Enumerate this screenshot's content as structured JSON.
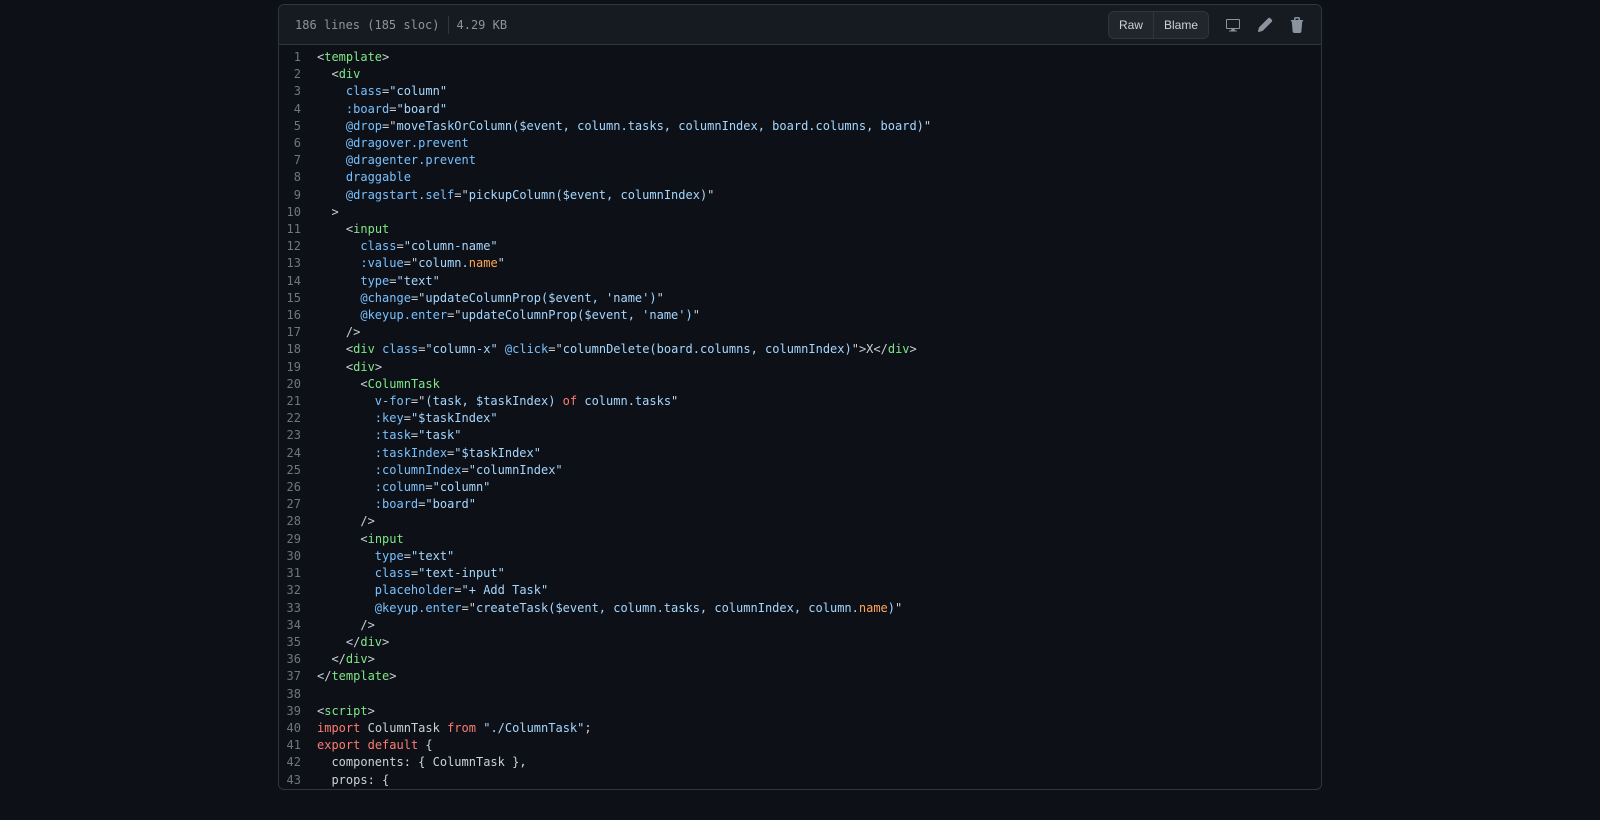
{
  "header": {
    "file_info": "186 lines (185 sloc)",
    "file_size": "4.29 KB",
    "raw_label": "Raw",
    "blame_label": "Blame"
  },
  "code": {
    "lines": [
      {
        "n": 1,
        "html": "<span class='punct'>&lt;</span><span class='tag'>template</span><span class='punct'>&gt;</span>"
      },
      {
        "n": 2,
        "html": "  <span class='punct'>&lt;</span><span class='tag'>div</span>"
      },
      {
        "n": 3,
        "html": "    <span class='attr'>class</span><span class='punct'>=</span><span class='str'>\"column\"</span>"
      },
      {
        "n": 4,
        "html": "    <span class='attr'>:board</span><span class='punct'>=</span><span class='str'>\"board\"</span>"
      },
      {
        "n": 5,
        "html": "    <span class='attr'>@drop</span><span class='punct'>=</span><span class='punct'>\"</span><span class='str'>moveTaskOrColumn($event, column.tasks, columnIndex, board.columns, board)</span><span class='punct'>\"</span>"
      },
      {
        "n": 6,
        "html": "    <span class='attr'>@dragover.prevent</span>"
      },
      {
        "n": 7,
        "html": "    <span class='attr'>@dragenter.prevent</span>"
      },
      {
        "n": 8,
        "html": "    <span class='attr'>draggable</span>"
      },
      {
        "n": 9,
        "html": "    <span class='attr'>@dragstart.self</span><span class='punct'>=</span><span class='punct'>\"</span><span class='str'>pickupColumn($event, columnIndex)</span><span class='punct'>\"</span>"
      },
      {
        "n": 10,
        "html": "  <span class='punct'>&gt;</span>"
      },
      {
        "n": 11,
        "html": "    <span class='punct'>&lt;</span><span class='tag'>input</span>"
      },
      {
        "n": 12,
        "html": "      <span class='attr'>class</span><span class='punct'>=</span><span class='str'>\"column-name\"</span>"
      },
      {
        "n": 13,
        "html": "      <span class='attr'>:value</span><span class='punct'>=</span><span class='punct'>\"</span><span class='str'>column.</span><span class='prop'>name</span><span class='punct'>\"</span>"
      },
      {
        "n": 14,
        "html": "      <span class='attr'>type</span><span class='punct'>=</span><span class='str'>\"text\"</span>"
      },
      {
        "n": 15,
        "html": "      <span class='attr'>@change</span><span class='punct'>=</span><span class='punct'>\"</span><span class='str'>updateColumnProp($event, 'name')</span><span class='punct'>\"</span>"
      },
      {
        "n": 16,
        "html": "      <span class='attr'>@keyup.enter</span><span class='punct'>=</span><span class='punct'>\"</span><span class='str'>updateColumnProp($event, 'name')</span><span class='punct'>\"</span>"
      },
      {
        "n": 17,
        "html": "    <span class='punct'>/&gt;</span>"
      },
      {
        "n": 18,
        "html": "    <span class='punct'>&lt;</span><span class='tag'>div</span> <span class='attr'>class</span><span class='punct'>=</span><span class='str'>\"column-x\"</span> <span class='attr'>@click</span><span class='punct'>=</span><span class='punct'>\"</span><span class='str'>columnDelete(board.columns, columnIndex)</span><span class='punct'>\"&gt;</span>X<span class='punct'>&lt;/</span><span class='tag'>div</span><span class='punct'>&gt;</span>"
      },
      {
        "n": 19,
        "html": "    <span class='punct'>&lt;</span><span class='tag'>div</span><span class='punct'>&gt;</span>"
      },
      {
        "n": 20,
        "html": "      <span class='punct'>&lt;</span><span class='tag'>ColumnTask</span>"
      },
      {
        "n": 21,
        "html": "        <span class='attr'>v-for</span><span class='punct'>=</span><span class='punct'>\"</span><span class='str'>(task, $taskIndex) </span><span class='kw'>of</span><span class='str'> column.tasks</span><span class='punct'>\"</span>"
      },
      {
        "n": 22,
        "html": "        <span class='attr'>:key</span><span class='punct'>=</span><span class='str'>\"$taskIndex\"</span>"
      },
      {
        "n": 23,
        "html": "        <span class='attr'>:task</span><span class='punct'>=</span><span class='str'>\"task\"</span>"
      },
      {
        "n": 24,
        "html": "        <span class='attr'>:taskIndex</span><span class='punct'>=</span><span class='str'>\"$taskIndex\"</span>"
      },
      {
        "n": 25,
        "html": "        <span class='attr'>:columnIndex</span><span class='punct'>=</span><span class='str'>\"columnIndex\"</span>"
      },
      {
        "n": 26,
        "html": "        <span class='attr'>:column</span><span class='punct'>=</span><span class='str'>\"column\"</span>"
      },
      {
        "n": 27,
        "html": "        <span class='attr'>:board</span><span class='punct'>=</span><span class='str'>\"board\"</span>"
      },
      {
        "n": 28,
        "html": "      <span class='punct'>/&gt;</span>"
      },
      {
        "n": 29,
        "html": "      <span class='punct'>&lt;</span><span class='tag'>input</span>"
      },
      {
        "n": 30,
        "html": "        <span class='attr'>type</span><span class='punct'>=</span><span class='str'>\"text\"</span>"
      },
      {
        "n": 31,
        "html": "        <span class='attr'>class</span><span class='punct'>=</span><span class='str'>\"text-input\"</span>"
      },
      {
        "n": 32,
        "html": "        <span class='attr'>placeholder</span><span class='punct'>=</span><span class='str'>\"+ Add Task\"</span>"
      },
      {
        "n": 33,
        "html": "        <span class='attr'>@keyup.enter</span><span class='punct'>=</span><span class='punct'>\"</span><span class='str'>createTask($event, column.tasks, columnIndex, column.</span><span class='prop'>name</span><span class='str'>)</span><span class='punct'>\"</span>"
      },
      {
        "n": 34,
        "html": "      <span class='punct'>/&gt;</span>"
      },
      {
        "n": 35,
        "html": "    <span class='punct'>&lt;/</span><span class='tag'>div</span><span class='punct'>&gt;</span>"
      },
      {
        "n": 36,
        "html": "  <span class='punct'>&lt;/</span><span class='tag'>div</span><span class='punct'>&gt;</span>"
      },
      {
        "n": 37,
        "html": "<span class='punct'>&lt;/</span><span class='tag'>template</span><span class='punct'>&gt;</span>"
      },
      {
        "n": 38,
        "html": ""
      },
      {
        "n": 39,
        "html": "<span class='punct'>&lt;</span><span class='tag'>script</span><span class='punct'>&gt;</span>"
      },
      {
        "n": 40,
        "html": "<span class='kw'>import</span> <span class='punct'>ColumnTask</span> <span class='kw'>from</span> <span class='str'>\"./ColumnTask\"</span><span class='punct'>;</span>"
      },
      {
        "n": 41,
        "html": "<span class='kw'>export</span> <span class='kw'>default</span> <span class='punct'>{</span>"
      },
      {
        "n": 42,
        "html": "  <span class='punct'>components</span><span class='punct'>: {</span> <span class='punct'>ColumnTask</span> <span class='punct'>},</span>"
      },
      {
        "n": 43,
        "html": "  <span class='punct'>props</span><span class='punct'>: {</span>"
      }
    ]
  }
}
